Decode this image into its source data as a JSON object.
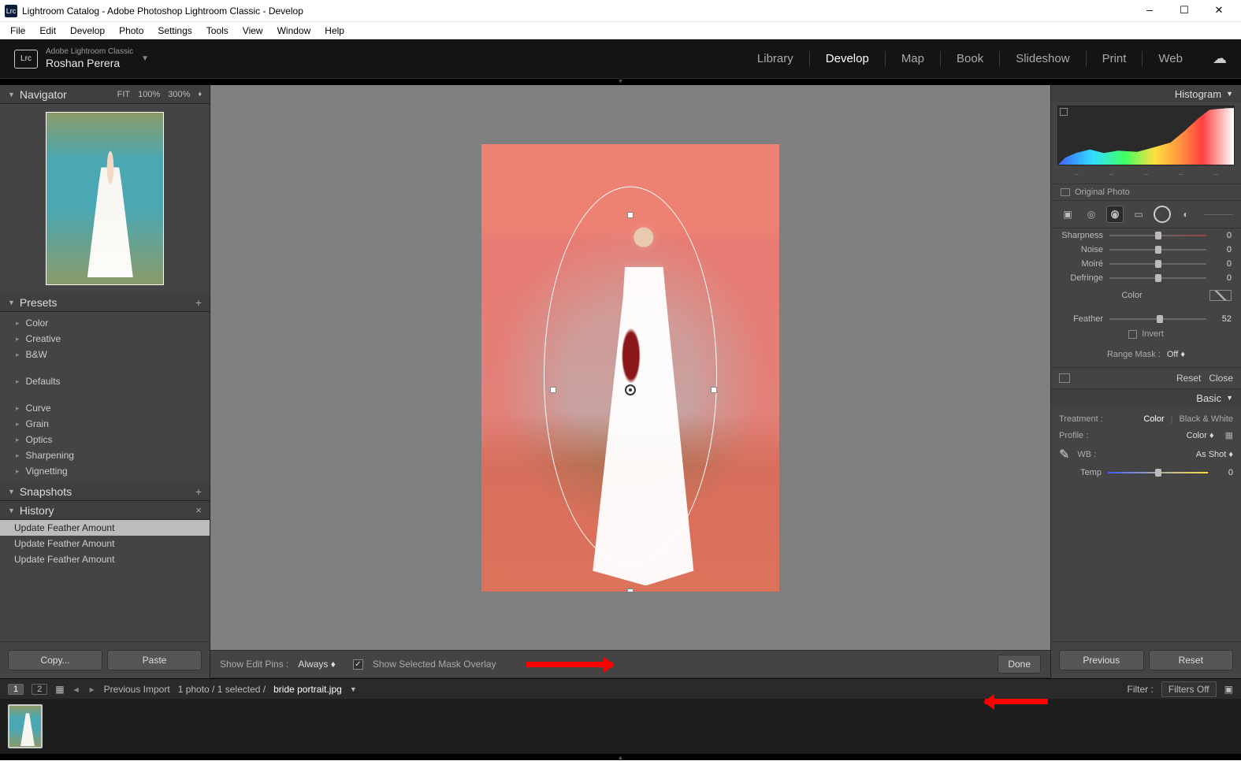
{
  "titlebar": {
    "icon": "Lrc",
    "title": "Lightroom Catalog - Adobe Photoshop Lightroom Classic - Develop"
  },
  "menu": [
    "File",
    "Edit",
    "Develop",
    "Photo",
    "Settings",
    "Tools",
    "View",
    "Window",
    "Help"
  ],
  "identity": {
    "brand": "Adobe Lightroom Classic",
    "user": "Roshan Perera"
  },
  "modules": [
    "Library",
    "Develop",
    "Map",
    "Book",
    "Slideshow",
    "Print",
    "Web"
  ],
  "active_module": "Develop",
  "navigator": {
    "title": "Navigator",
    "zoom": [
      "FIT",
      "100%",
      "300%"
    ]
  },
  "presets": {
    "title": "Presets",
    "groups1": [
      "Color",
      "Creative",
      "B&W"
    ],
    "groups2": [
      "Defaults"
    ],
    "groups3": [
      "Curve",
      "Grain",
      "Optics",
      "Sharpening",
      "Vignetting"
    ]
  },
  "snapshots": {
    "title": "Snapshots"
  },
  "history": {
    "title": "History",
    "items": [
      "Update Feather Amount",
      "Update Feather Amount",
      "Update Feather Amount"
    ]
  },
  "left_buttons": {
    "copy": "Copy...",
    "paste": "Paste"
  },
  "center_toolbar": {
    "pins_label": "Show Edit Pins :",
    "pins_value": "Always",
    "overlay_label": "Show Selected Mask Overlay",
    "overlay_checked": true,
    "done": "Done"
  },
  "histogram": {
    "title": "Histogram",
    "original": "Original Photo"
  },
  "detail_sliders": [
    {
      "label": "Sharpness",
      "value": "0",
      "pos": 50,
      "cls": "sharp"
    },
    {
      "label": "Noise",
      "value": "0",
      "pos": 50,
      "cls": ""
    },
    {
      "label": "Moiré",
      "value": "0",
      "pos": 50,
      "cls": ""
    },
    {
      "label": "Defringe",
      "value": "0",
      "pos": 50,
      "cls": ""
    }
  ],
  "color_label": "Color",
  "feather": {
    "label": "Feather",
    "value": "52",
    "pos": 52
  },
  "invert_label": "Invert",
  "range_mask": {
    "label": "Range Mask :",
    "value": "Off"
  },
  "reset_row": {
    "reset": "Reset",
    "close": "Close"
  },
  "basic": {
    "title": "Basic",
    "treatment_label": "Treatment :",
    "treatment_color": "Color",
    "treatment_bw": "Black & White",
    "profile_label": "Profile :",
    "profile_value": "Color",
    "wb_label": "WB :",
    "wb_value": "As Shot",
    "temp_label": "Temp",
    "temp_value": "0"
  },
  "right_buttons": {
    "prev": "Previous",
    "reset": "Reset"
  },
  "status": {
    "pages": [
      "1",
      "2"
    ],
    "prev_import": "Previous Import",
    "crumb": "1 photo / 1 selected /",
    "file": "bride portrait.jpg",
    "filter_label": "Filter :",
    "filter_value": "Filters Off"
  }
}
